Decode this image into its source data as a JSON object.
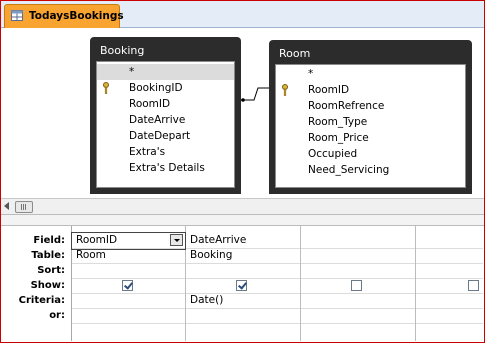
{
  "tab": {
    "label": "TodaysBookings",
    "icon": "query-icon",
    "accent": "#f9a430"
  },
  "tables": [
    {
      "title": "Booking",
      "fields": [
        "*",
        "BookingID",
        "RoomID",
        "DateArrive",
        "DateDepart",
        "Extra's",
        "Extra's Details"
      ],
      "key_field": "BookingID"
    },
    {
      "title": "Room",
      "fields": [
        "*",
        "RoomID",
        "RoomRefrence",
        "Room_Type",
        "Room_Price",
        "Occupied",
        "Need_Servicing"
      ],
      "key_field": "RoomID"
    }
  ],
  "grid": {
    "row_labels": [
      "Field:",
      "Table:",
      "Sort:",
      "Show:",
      "Criteria:",
      "or:"
    ],
    "columns": [
      {
        "field": "RoomID",
        "table": "Room",
        "sort": "",
        "show": true,
        "criteria": "",
        "or": ""
      },
      {
        "field": "DateArrive",
        "table": "Booking",
        "sort": "",
        "show": true,
        "criteria": "Date()",
        "or": ""
      },
      {
        "field": "",
        "table": "",
        "sort": "",
        "show": false,
        "criteria": "",
        "or": ""
      },
      {
        "field": "",
        "table": "",
        "sort": "",
        "show": false,
        "criteria": "",
        "or": ""
      }
    ]
  }
}
